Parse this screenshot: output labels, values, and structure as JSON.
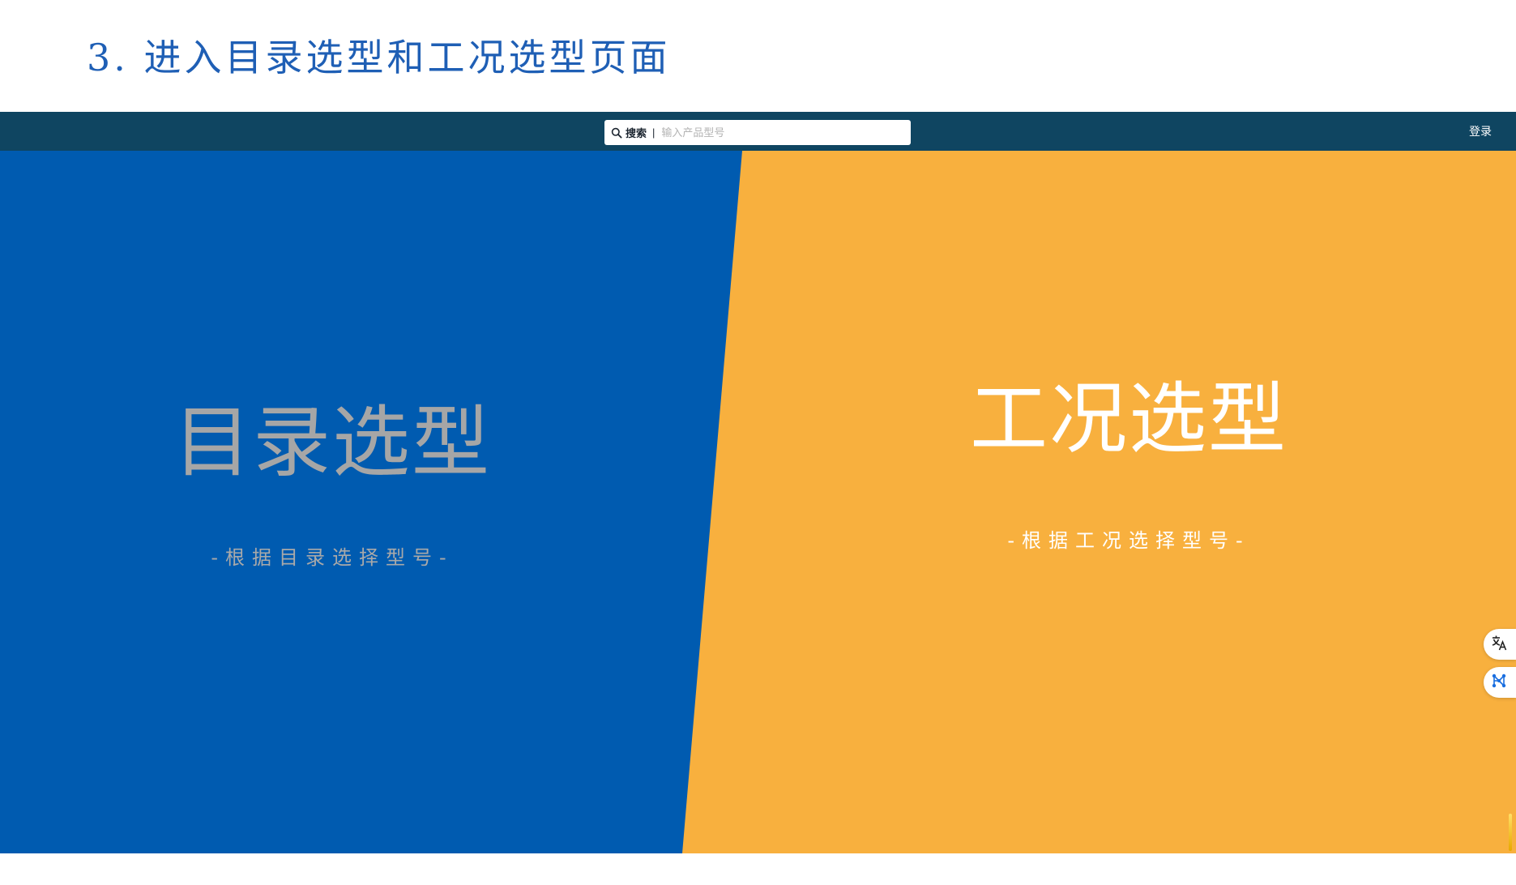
{
  "slide": {
    "title": "3. 进入目录选型和工况选型页面"
  },
  "navbar": {
    "search_icon": "search-icon",
    "search_label": "搜索",
    "search_divider": "|",
    "search_placeholder": "输入产品型号",
    "search_value": "",
    "login_label": "登录"
  },
  "panels": {
    "catalog": {
      "title": "目录选型",
      "subtitle": "-根据目录选择型号-"
    },
    "condition": {
      "title": "工况选型",
      "subtitle": "-根据工况选择型号-"
    }
  },
  "floating_tools": [
    {
      "icon": "translate-icon"
    },
    {
      "icon": "network-icon"
    }
  ],
  "colors": {
    "slide_title": "#1f5fb5",
    "navbar": "#0f4561",
    "catalog_panel": "#005bb0",
    "catalog_text": "#a6a6a6",
    "condition_panel": "#f8b03e",
    "condition_text": "#ffffff",
    "network_icon": "#1a6fe0"
  }
}
